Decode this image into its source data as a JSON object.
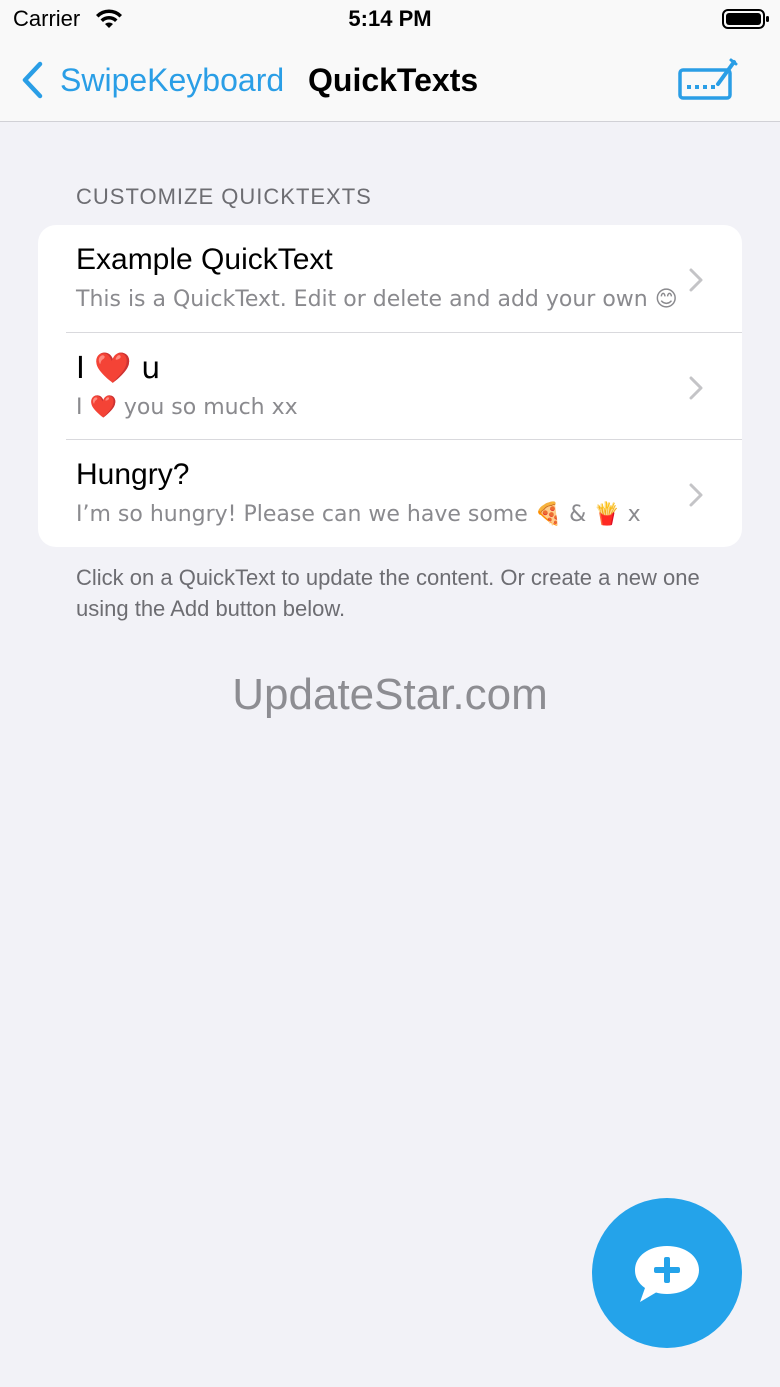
{
  "status_bar": {
    "carrier": "Carrier",
    "time": "5:14 PM"
  },
  "nav": {
    "back_label": "SwipeKeyboard",
    "title": "QuickTexts",
    "accent_color": "#2a9ee6"
  },
  "section": {
    "header": "CUSTOMIZE QUICKTEXTS",
    "items": [
      {
        "title": "Example QuickText",
        "subtitle": "This is a QuickText. Edit or delete and add your own 😊"
      },
      {
        "title": "I ❤️ u",
        "subtitle": "I ❤️ you so much xx"
      },
      {
        "title": "Hungry?",
        "subtitle": "I’m so hungry! Please can we have some 🍕 & 🍟 x"
      }
    ],
    "footer": "Click on a QuickText to update the content. Or create a new one using the Add button below."
  },
  "watermark": "UpdateStar.com",
  "fab": {
    "icon": "add-message-icon",
    "color": "#24a3ea"
  }
}
